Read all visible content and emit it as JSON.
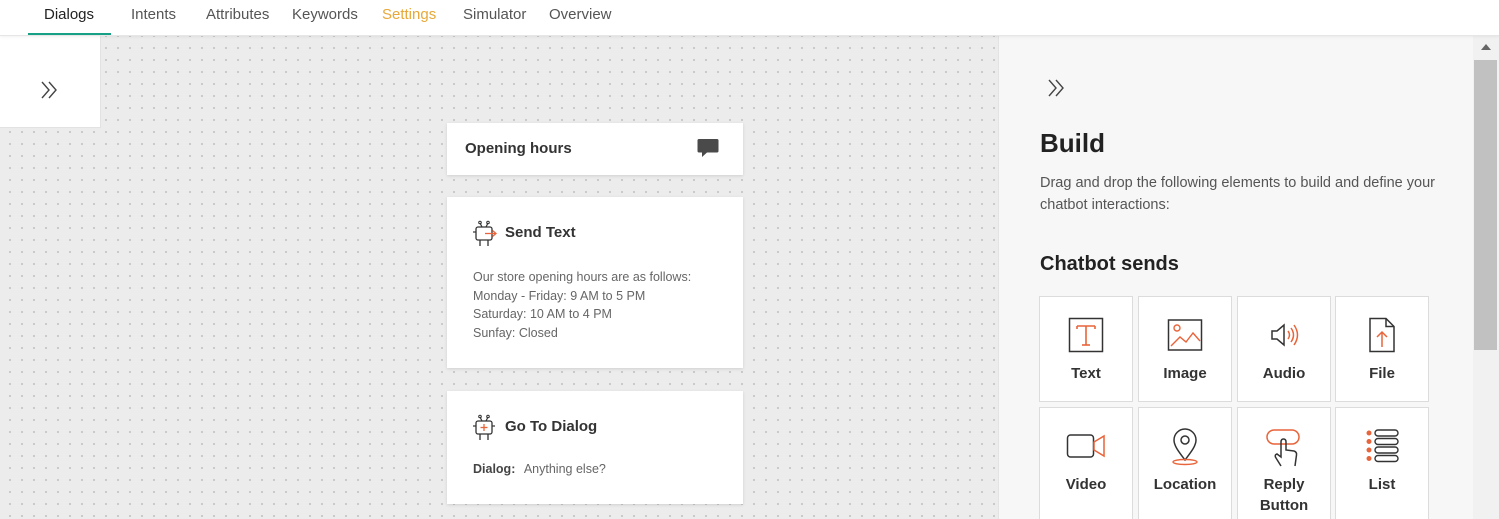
{
  "nav": {
    "tabs": [
      {
        "label": "Dialogs"
      },
      {
        "label": "Intents"
      },
      {
        "label": "Attributes"
      },
      {
        "label": "Keywords"
      },
      {
        "label": "Settings"
      },
      {
        "label": "Simulator"
      },
      {
        "label": "Overview"
      }
    ],
    "active_tab": "Dialogs"
  },
  "canvas": {
    "dialog_card": {
      "title": "Opening hours",
      "icon": "chat-bubble-icon"
    },
    "send_text_card": {
      "title": "Send Text",
      "icon": "robot-send-icon",
      "lines": [
        "Our store opening hours are as follows:",
        "Monday - Friday: 9 AM to 5 PM",
        "Saturday: 10 AM to 4 PM",
        "Sunfay: Closed"
      ]
    },
    "goto_card": {
      "title": "Go To Dialog",
      "icon": "robot-plus-icon",
      "dialog_label": "Dialog:",
      "dialog_value": "Anything else?"
    }
  },
  "panel": {
    "title": "Build",
    "description": "Drag and drop the following elements to build and define your chatbot interactions:",
    "section_title": "Chatbot sends",
    "elements": [
      {
        "label": "Text",
        "icon": "text-icon"
      },
      {
        "label": "Image",
        "icon": "image-icon"
      },
      {
        "label": "Audio",
        "icon": "audio-icon"
      },
      {
        "label": "File",
        "icon": "file-icon"
      },
      {
        "label": "Video",
        "icon": "video-icon"
      },
      {
        "label": "Location",
        "icon": "location-icon"
      },
      {
        "label": "Reply Button",
        "icon": "reply-button-icon"
      },
      {
        "label": "List",
        "icon": "list-icon"
      }
    ]
  },
  "colors": {
    "accent_green": "#16a085",
    "settings_orange": "#e8a838",
    "icon_orange": "#e8643a"
  }
}
